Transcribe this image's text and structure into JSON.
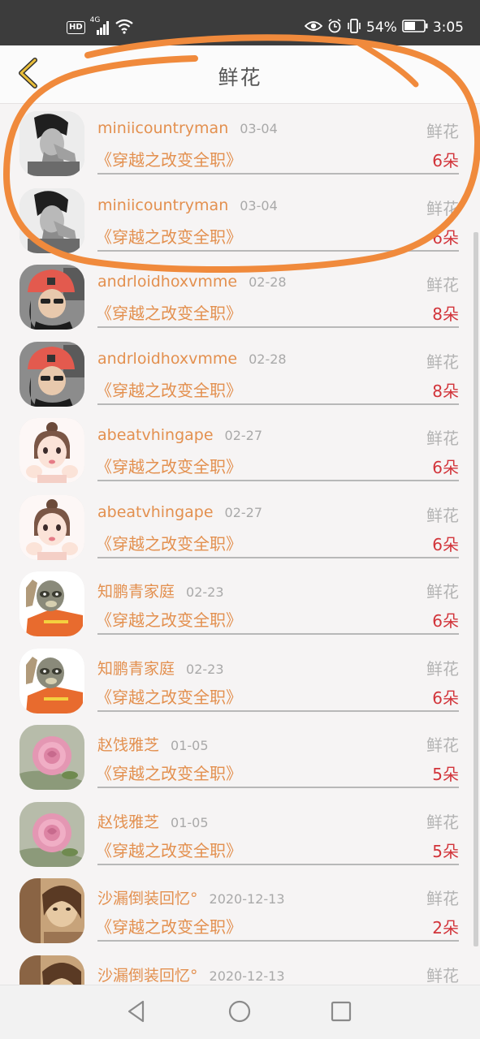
{
  "status_bar": {
    "hd": "HD",
    "network": "4G",
    "battery": "54%",
    "time": "3:05",
    "icons": [
      "hd-badge",
      "signal-icon",
      "wifi-icon",
      "eye-icon",
      "alarm-icon",
      "vibrate-icon",
      "battery-icon"
    ]
  },
  "header": {
    "title": "鲜花",
    "back_icon": "chevron-left-icon"
  },
  "colors": {
    "accent": "#e3904f",
    "count": "#d2343a",
    "muted": "#a9a9a9",
    "annotation": "#f08a3c"
  },
  "rows": [
    {
      "user": "miniicountryman",
      "date": "03-04",
      "book": "《穿越之改变全职》",
      "gift": "鲜花",
      "count": "6朵",
      "avatar": "man-bw"
    },
    {
      "user": "miniicountryman",
      "date": "03-04",
      "book": "《穿越之改变全职》",
      "gift": "鲜花",
      "count": "6朵",
      "avatar": "man-bw"
    },
    {
      "user": "andrloidhoxvmme",
      "date": "02-28",
      "book": "《穿越之改变全职》",
      "gift": "鲜花",
      "count": "8朵",
      "avatar": "red-helmet"
    },
    {
      "user": "andrloidhoxvmme",
      "date": "02-28",
      "book": "《穿越之改变全职》",
      "gift": "鲜花",
      "count": "8朵",
      "avatar": "red-helmet"
    },
    {
      "user": "abeatvhingape",
      "date": "02-27",
      "book": "《穿越之改变全职》",
      "gift": "鲜花",
      "count": "6朵",
      "avatar": "cartoon-girl"
    },
    {
      "user": "abeatvhingape",
      "date": "02-27",
      "book": "《穿越之改变全职》",
      "gift": "鲜花",
      "count": "6朵",
      "avatar": "cartoon-girl"
    },
    {
      "user": "知鹏青家庭",
      "date": "02-23",
      "book": "《穿越之改变全职》",
      "gift": "鲜花",
      "count": "6朵",
      "avatar": "sloth"
    },
    {
      "user": "知鹏青家庭",
      "date": "02-23",
      "book": "《穿越之改变全职》",
      "gift": "鲜花",
      "count": "6朵",
      "avatar": "sloth"
    },
    {
      "user": "赵饯雅芝",
      "date": "01-05",
      "book": "《穿越之改变全职》",
      "gift": "鲜花",
      "count": "5朵",
      "avatar": "rose"
    },
    {
      "user": "赵饯雅芝",
      "date": "01-05",
      "book": "《穿越之改变全职》",
      "gift": "鲜花",
      "count": "5朵",
      "avatar": "rose"
    },
    {
      "user": "沙漏倒装回忆°",
      "date": "2020-12-13",
      "book": "《穿越之改变全职》",
      "gift": "鲜花",
      "count": "2朵",
      "avatar": "sepia-girl"
    },
    {
      "user": "沙漏倒装回忆°",
      "date": "2020-12-13",
      "book": "",
      "gift": "鲜花",
      "count": "",
      "avatar": "sepia-girl"
    }
  ],
  "nav_bar": {
    "icons": [
      "back-triangle-icon",
      "home-circle-icon",
      "recents-square-icon"
    ]
  }
}
